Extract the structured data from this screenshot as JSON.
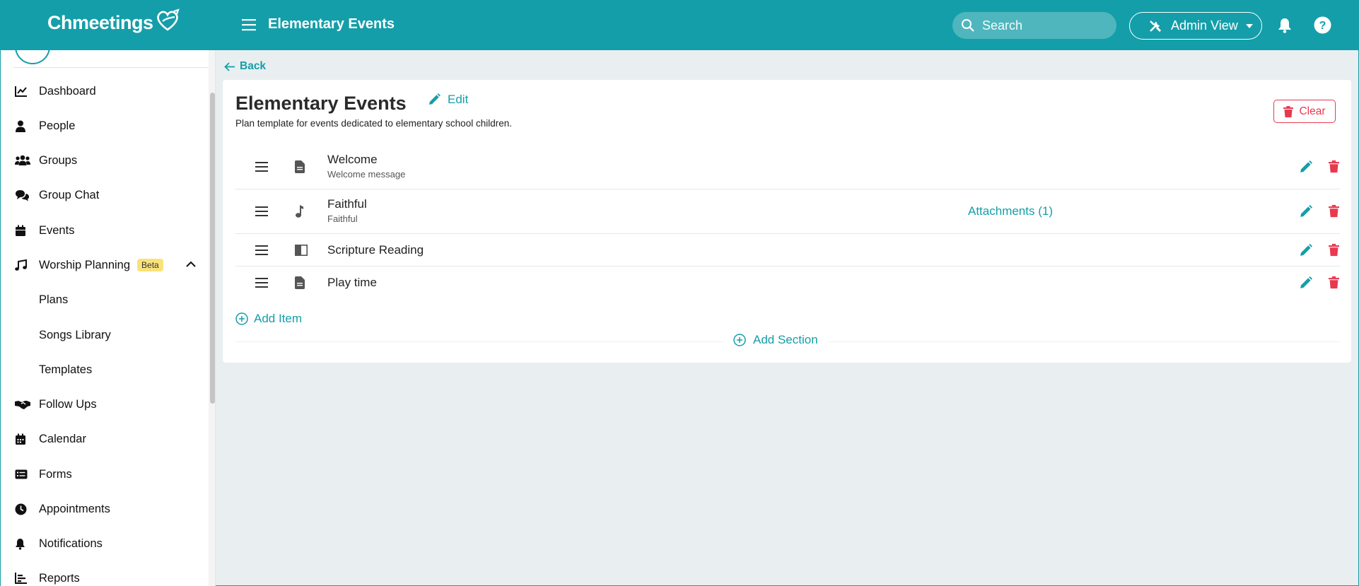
{
  "app": {
    "brand": "Chmeetings",
    "page_title": "Elementary Events",
    "accent_color": "#149ea9",
    "danger_color": "#e8394f"
  },
  "header": {
    "search_placeholder": "Search",
    "admin_label": "Admin View",
    "icons": [
      "menu-icon",
      "search-icon",
      "tools-icon",
      "caret-down-icon",
      "bell-icon",
      "help-icon"
    ]
  },
  "sidebar": {
    "items": [
      {
        "label": "Dashboard",
        "icon": "chart-line-icon"
      },
      {
        "label": "People",
        "icon": "person-icon"
      },
      {
        "label": "Groups",
        "icon": "users-icon"
      },
      {
        "label": "Group Chat",
        "icon": "chat-icon"
      },
      {
        "label": "Events",
        "icon": "calendar-icon"
      },
      {
        "label": "Worship Planning",
        "icon": "music-icon",
        "badge": "Beta",
        "expanded": true
      },
      {
        "label": "Plans",
        "sub": true
      },
      {
        "label": "Songs Library",
        "sub": true
      },
      {
        "label": "Templates",
        "sub": true
      },
      {
        "label": "Follow Ups",
        "icon": "handshake-icon"
      },
      {
        "label": "Calendar",
        "icon": "calendar-days-icon"
      },
      {
        "label": "Forms",
        "icon": "form-icon"
      },
      {
        "label": "Appointments",
        "icon": "clock-icon"
      },
      {
        "label": "Notifications",
        "icon": "bell-icon"
      },
      {
        "label": "Reports",
        "icon": "bar-chart-icon"
      }
    ]
  },
  "main": {
    "back_label": "Back",
    "title": "Elementary Events",
    "edit_label": "Edit",
    "subtitle": "Plan template for events dedicated to elementary school children.",
    "clear_label": "Clear",
    "items": [
      {
        "title": "Welcome",
        "subtitle": "Welcome message",
        "type_icon": "document-icon",
        "attachments": ""
      },
      {
        "title": "Faithful",
        "subtitle": "Faithful",
        "type_icon": "music-note-icon",
        "attachments": "Attachments (1)"
      },
      {
        "title": "Scripture Reading",
        "subtitle": "",
        "type_icon": "book-open-icon",
        "attachments": ""
      },
      {
        "title": "Play time",
        "subtitle": "",
        "type_icon": "document-icon",
        "attachments": ""
      }
    ],
    "add_item_label": "Add Item",
    "add_section_label": "Add Section"
  }
}
